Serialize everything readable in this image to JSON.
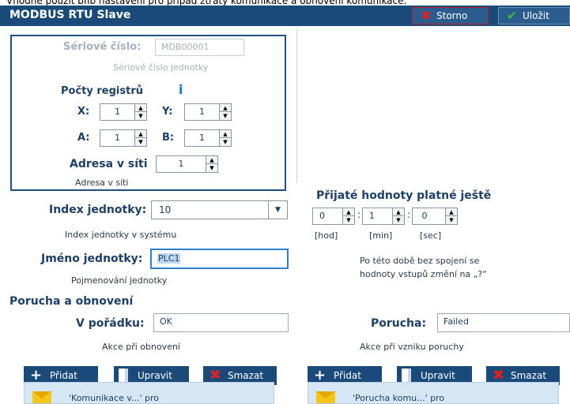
{
  "top_cut_text": "Vhodné použít bfib nastavení pro případ ztráty komunikace a obnovení komunikace.",
  "window": {
    "title": "MODBUS RTU Slave",
    "cancel_label": "Storno",
    "save_label": "Uložit"
  },
  "serial": {
    "label": "Sériové číslo:",
    "value": "MDB00001",
    "hint": "Sériové číslo jednotky"
  },
  "registers": {
    "title": "Počty registrů",
    "info_icon": "i",
    "x_label": "X:",
    "x_value": "1",
    "y_label": "Y:",
    "y_value": "1",
    "a_label": "A:",
    "a_value": "1",
    "b_label": "B:",
    "b_value": "1"
  },
  "address": {
    "label": "Adresa v síti",
    "value": "1",
    "hint": "Adresa v síti"
  },
  "unit_index": {
    "label": "Index jednotky:",
    "value": "10",
    "hint": "Index jednotky v systému"
  },
  "unit_name": {
    "label": "Jméno jednotky:",
    "value": "PLC1",
    "hint": "Pojmenování jednotky"
  },
  "validity": {
    "title": "Přijaté hodnoty platné ještě",
    "hours": "0",
    "minutes": "1",
    "seconds": "0",
    "sep": ":",
    "hours_label": "[hod]",
    "minutes_label": "[min]",
    "seconds_label": "[sec]",
    "note_line1": "Po této době bez spojení se",
    "note_line2": "hodnoty vstupů změní na „?“"
  },
  "fault": {
    "section_title": "Porucha a obnovení",
    "ok_label": "V pořádku:",
    "ok_value": "OK",
    "ok_hint": "Akce při obnovení",
    "fail_label": "Porucha:",
    "fail_value": "Failed",
    "fail_hint": "Akce při vzniku poruchy"
  },
  "actions": {
    "add": "Přidat",
    "edit": "Upravit",
    "delete": "Smazat"
  },
  "lists": {
    "left_item": "'Komunikace v...' pro",
    "right_item": "'Porucha komu...' pro"
  },
  "colors": {
    "title_bar": "#1a4a7a",
    "label_blue": "#1e3f66",
    "list_bg": "#d5e6f5",
    "focus": "#2d7fd0"
  }
}
